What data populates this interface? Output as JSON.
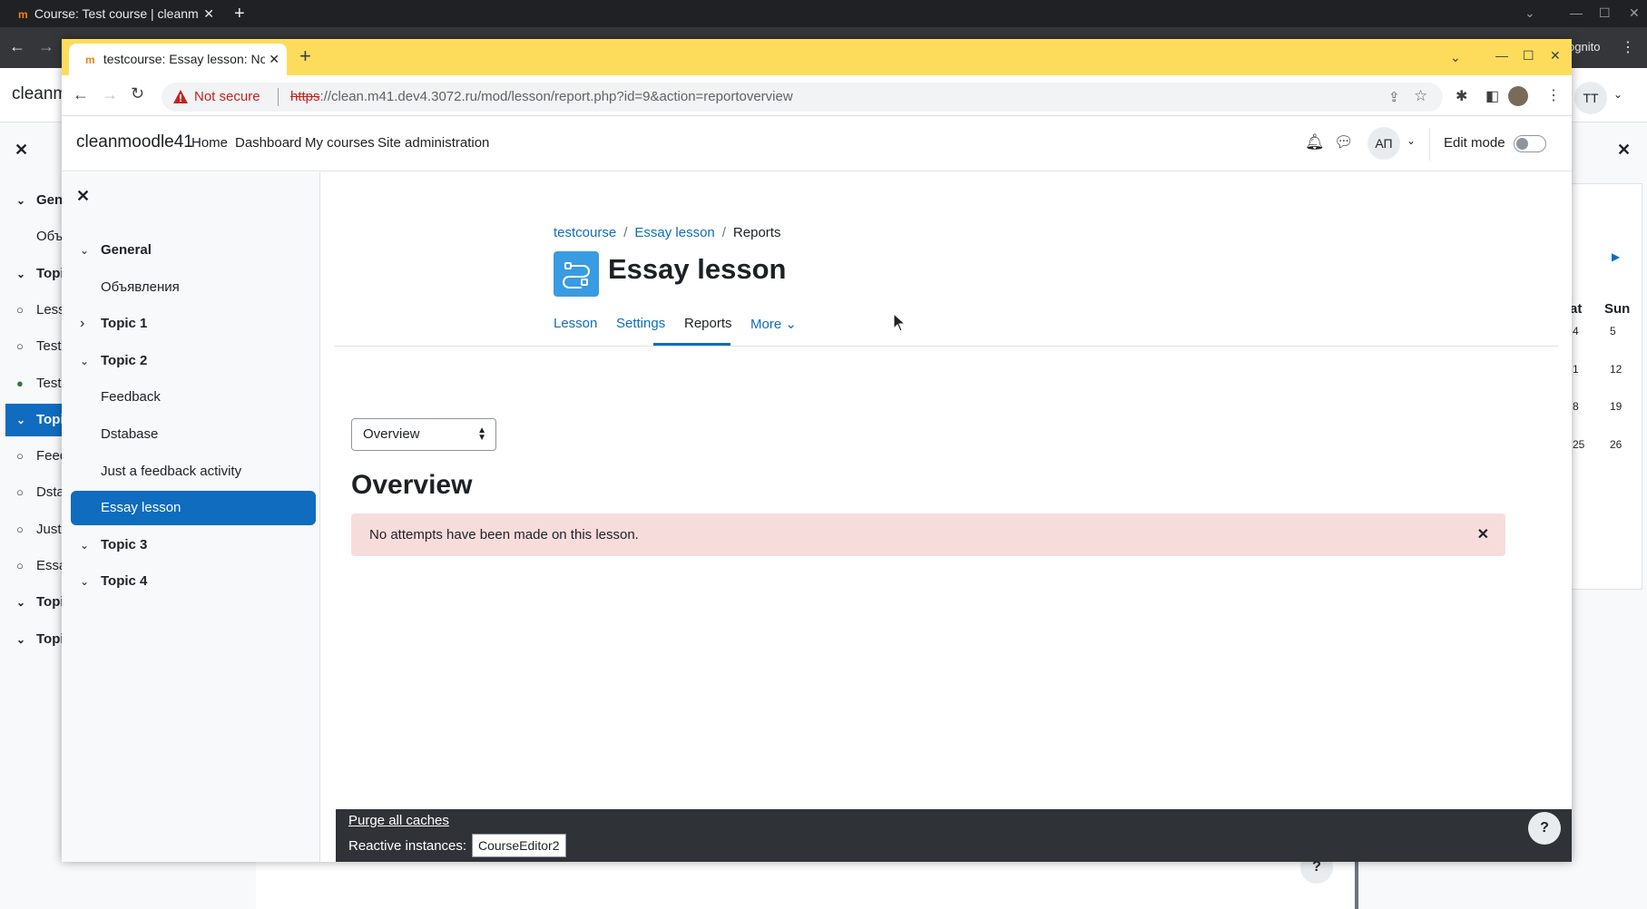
{
  "bg": {
    "tab_title": "Course: Test course | cleanm",
    "brand": "cleanm",
    "incognito": "ognito",
    "user_initials": "TT",
    "topic_items": [
      {
        "label": "Gen",
        "bold": true,
        "chev": "⌄",
        "icon": ""
      },
      {
        "label": "Объ",
        "bold": false,
        "chev": "",
        "icon": ""
      },
      {
        "label": "Topi",
        "bold": true,
        "chev": "⌄",
        "icon": ""
      },
      {
        "label": "Less",
        "bold": false,
        "chev": "",
        "icon": "○"
      },
      {
        "label": "Test",
        "bold": false,
        "chev": "",
        "icon": "○"
      },
      {
        "label": "Test",
        "bold": false,
        "chev": "",
        "icon": "●"
      },
      {
        "label": "Topi",
        "bold": true,
        "chev": "⌄",
        "icon": "",
        "active": true
      },
      {
        "label": "Feed",
        "bold": false,
        "chev": "",
        "icon": "○"
      },
      {
        "label": "Dsta",
        "bold": false,
        "chev": "",
        "icon": "○"
      },
      {
        "label": "Just",
        "bold": false,
        "chev": "",
        "icon": "○"
      },
      {
        "label": "Essa",
        "bold": false,
        "chev": "",
        "icon": "○"
      },
      {
        "label": "Topi",
        "bold": true,
        "chev": "⌄",
        "icon": ""
      },
      {
        "label": "Topi",
        "bold": true,
        "chev": "⌄",
        "icon": ""
      }
    ],
    "calendar": {
      "headers": [
        "at",
        "Sun"
      ],
      "rows": [
        [
          "4",
          "5"
        ],
        [
          "1",
          "12"
        ],
        [
          "8",
          "19"
        ],
        [
          "25",
          "26"
        ]
      ]
    }
  },
  "browser": {
    "tab_title": "testcourse: Essay lesson: No",
    "not_secure": "Not secure",
    "url_scheme": "https",
    "url_rest": "://clean.m41.dev4.3072.ru/mod/lesson/report.php?id=9&action=reportoverview"
  },
  "navbar": {
    "site_name": "cleanmoodle41",
    "links": [
      "Home",
      "Dashboard",
      "My courses",
      "Site administration"
    ],
    "user_initials": "АП",
    "edit_mode_label": "Edit mode",
    "edit_mode_on": false
  },
  "course_index": {
    "items": [
      {
        "label": "General",
        "type": "section",
        "expanded": true
      },
      {
        "label": "Объявления",
        "type": "activity"
      },
      {
        "label": "Topic 1",
        "type": "section",
        "expanded": false
      },
      {
        "label": "Topic 2",
        "type": "section",
        "expanded": true
      },
      {
        "label": "Feedback",
        "type": "activity"
      },
      {
        "label": "Dstabase",
        "type": "activity"
      },
      {
        "label": "Just a feedback activity",
        "type": "activity"
      },
      {
        "label": "Essay lesson",
        "type": "activity",
        "active": true
      },
      {
        "label": "Topic 3",
        "type": "section",
        "expanded": true
      },
      {
        "label": "Topic 4",
        "type": "section",
        "expanded": true
      }
    ]
  },
  "breadcrumb": {
    "items": [
      "testcourse",
      "Essay lesson",
      "Reports"
    ]
  },
  "page": {
    "title": "Essay lesson",
    "tabs": [
      "Lesson",
      "Settings",
      "Reports",
      "More"
    ],
    "current_tab": "Reports",
    "report_select": "Overview",
    "heading": "Overview",
    "alert": "No attempts have been made on this lesson.",
    "alert_color": "#f7dcdc"
  },
  "footer": {
    "purge": "Purge all caches",
    "reactive_label": "Reactive instances:",
    "reactive_button": "CourseEditor2",
    "help": "?"
  },
  "colors": {
    "accent": "#0f6cbf",
    "activity_icon": "#399be2",
    "chrome_tab_bar": "#fddc5c"
  }
}
